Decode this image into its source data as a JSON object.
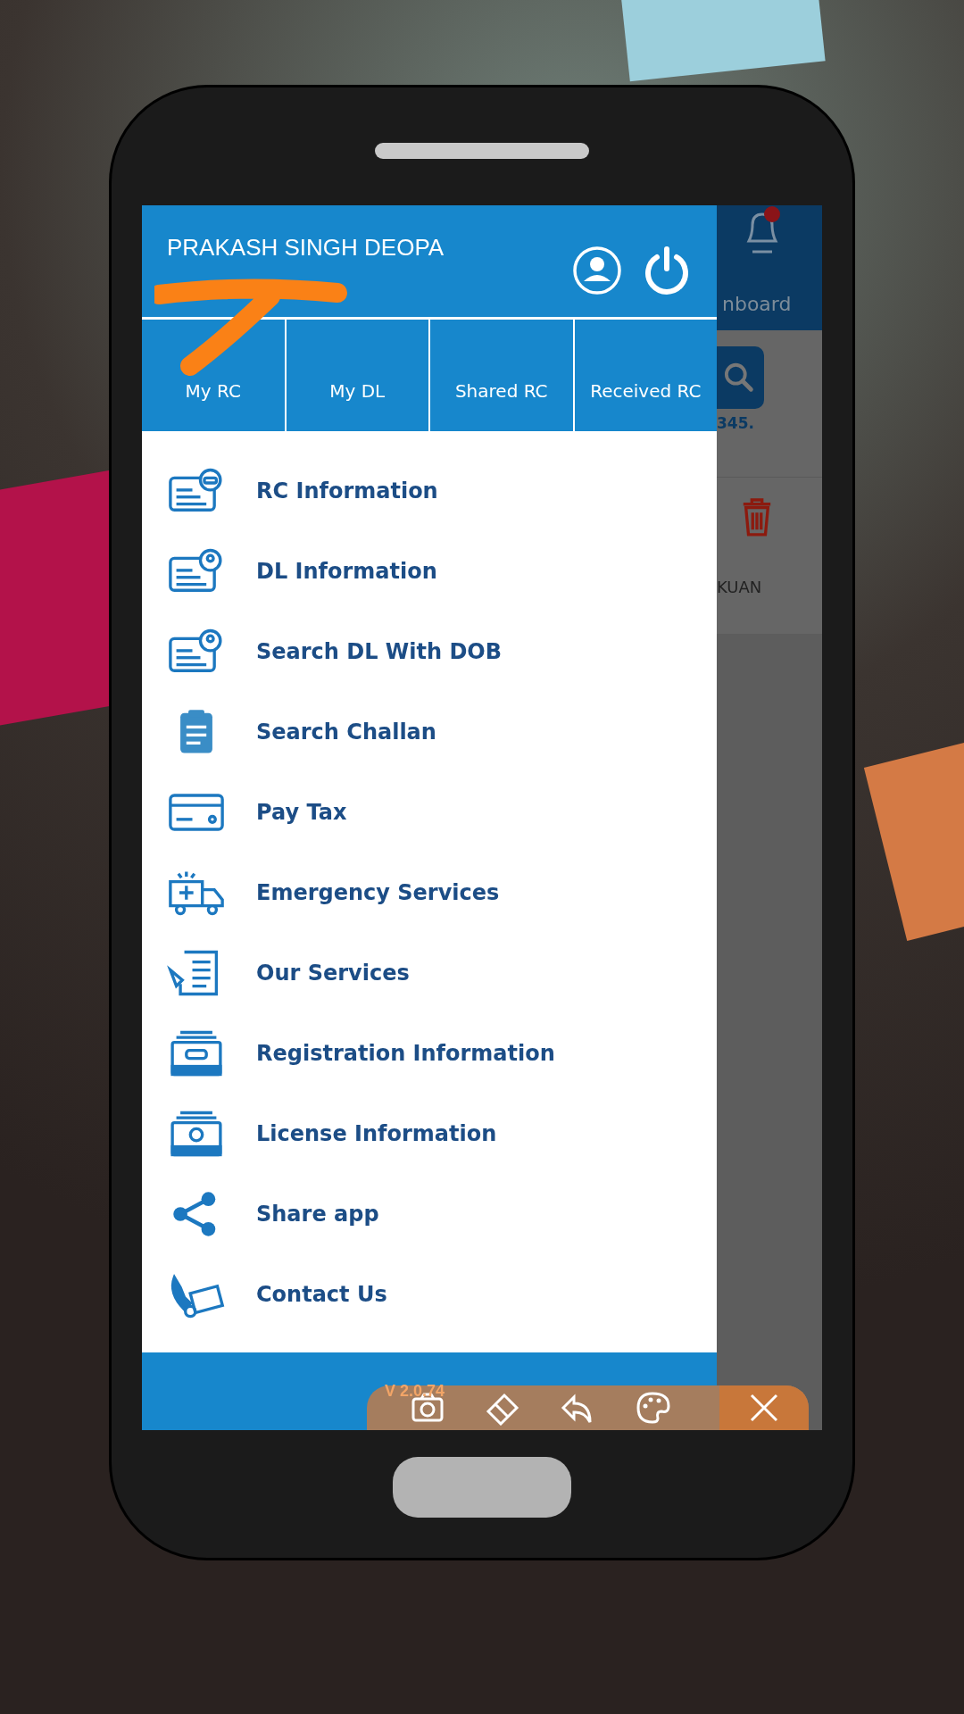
{
  "drawer": {
    "user_name": "PRAKASH SINGH DEOPA",
    "tabs": [
      {
        "label": "My RC"
      },
      {
        "label": "My DL"
      },
      {
        "label": "Shared RC"
      },
      {
        "label": "Received RC"
      }
    ],
    "menu": [
      {
        "label": "RC Information",
        "kind": "card-car"
      },
      {
        "label": "DL Information",
        "kind": "card-person"
      },
      {
        "label": "Search DL With DOB",
        "kind": "card-person"
      },
      {
        "label": "Search Challan",
        "kind": "clipboard"
      },
      {
        "label": "Pay Tax",
        "kind": "pay-card"
      },
      {
        "label": "Emergency Services",
        "kind": "ambulance"
      },
      {
        "label": "Our Services",
        "kind": "checklist"
      },
      {
        "label": "Registration Information",
        "kind": "tray-car"
      },
      {
        "label": "License Information",
        "kind": "tray-person"
      },
      {
        "label": "Share app",
        "kind": "share"
      },
      {
        "label": "Contact Us",
        "kind": "phone-mail"
      }
    ]
  },
  "background_app": {
    "header_text": "nboard",
    "search_caption": "345.",
    "row_text": "KUAN"
  },
  "annotation_toolbar": {
    "version": "V 2.0.74"
  }
}
